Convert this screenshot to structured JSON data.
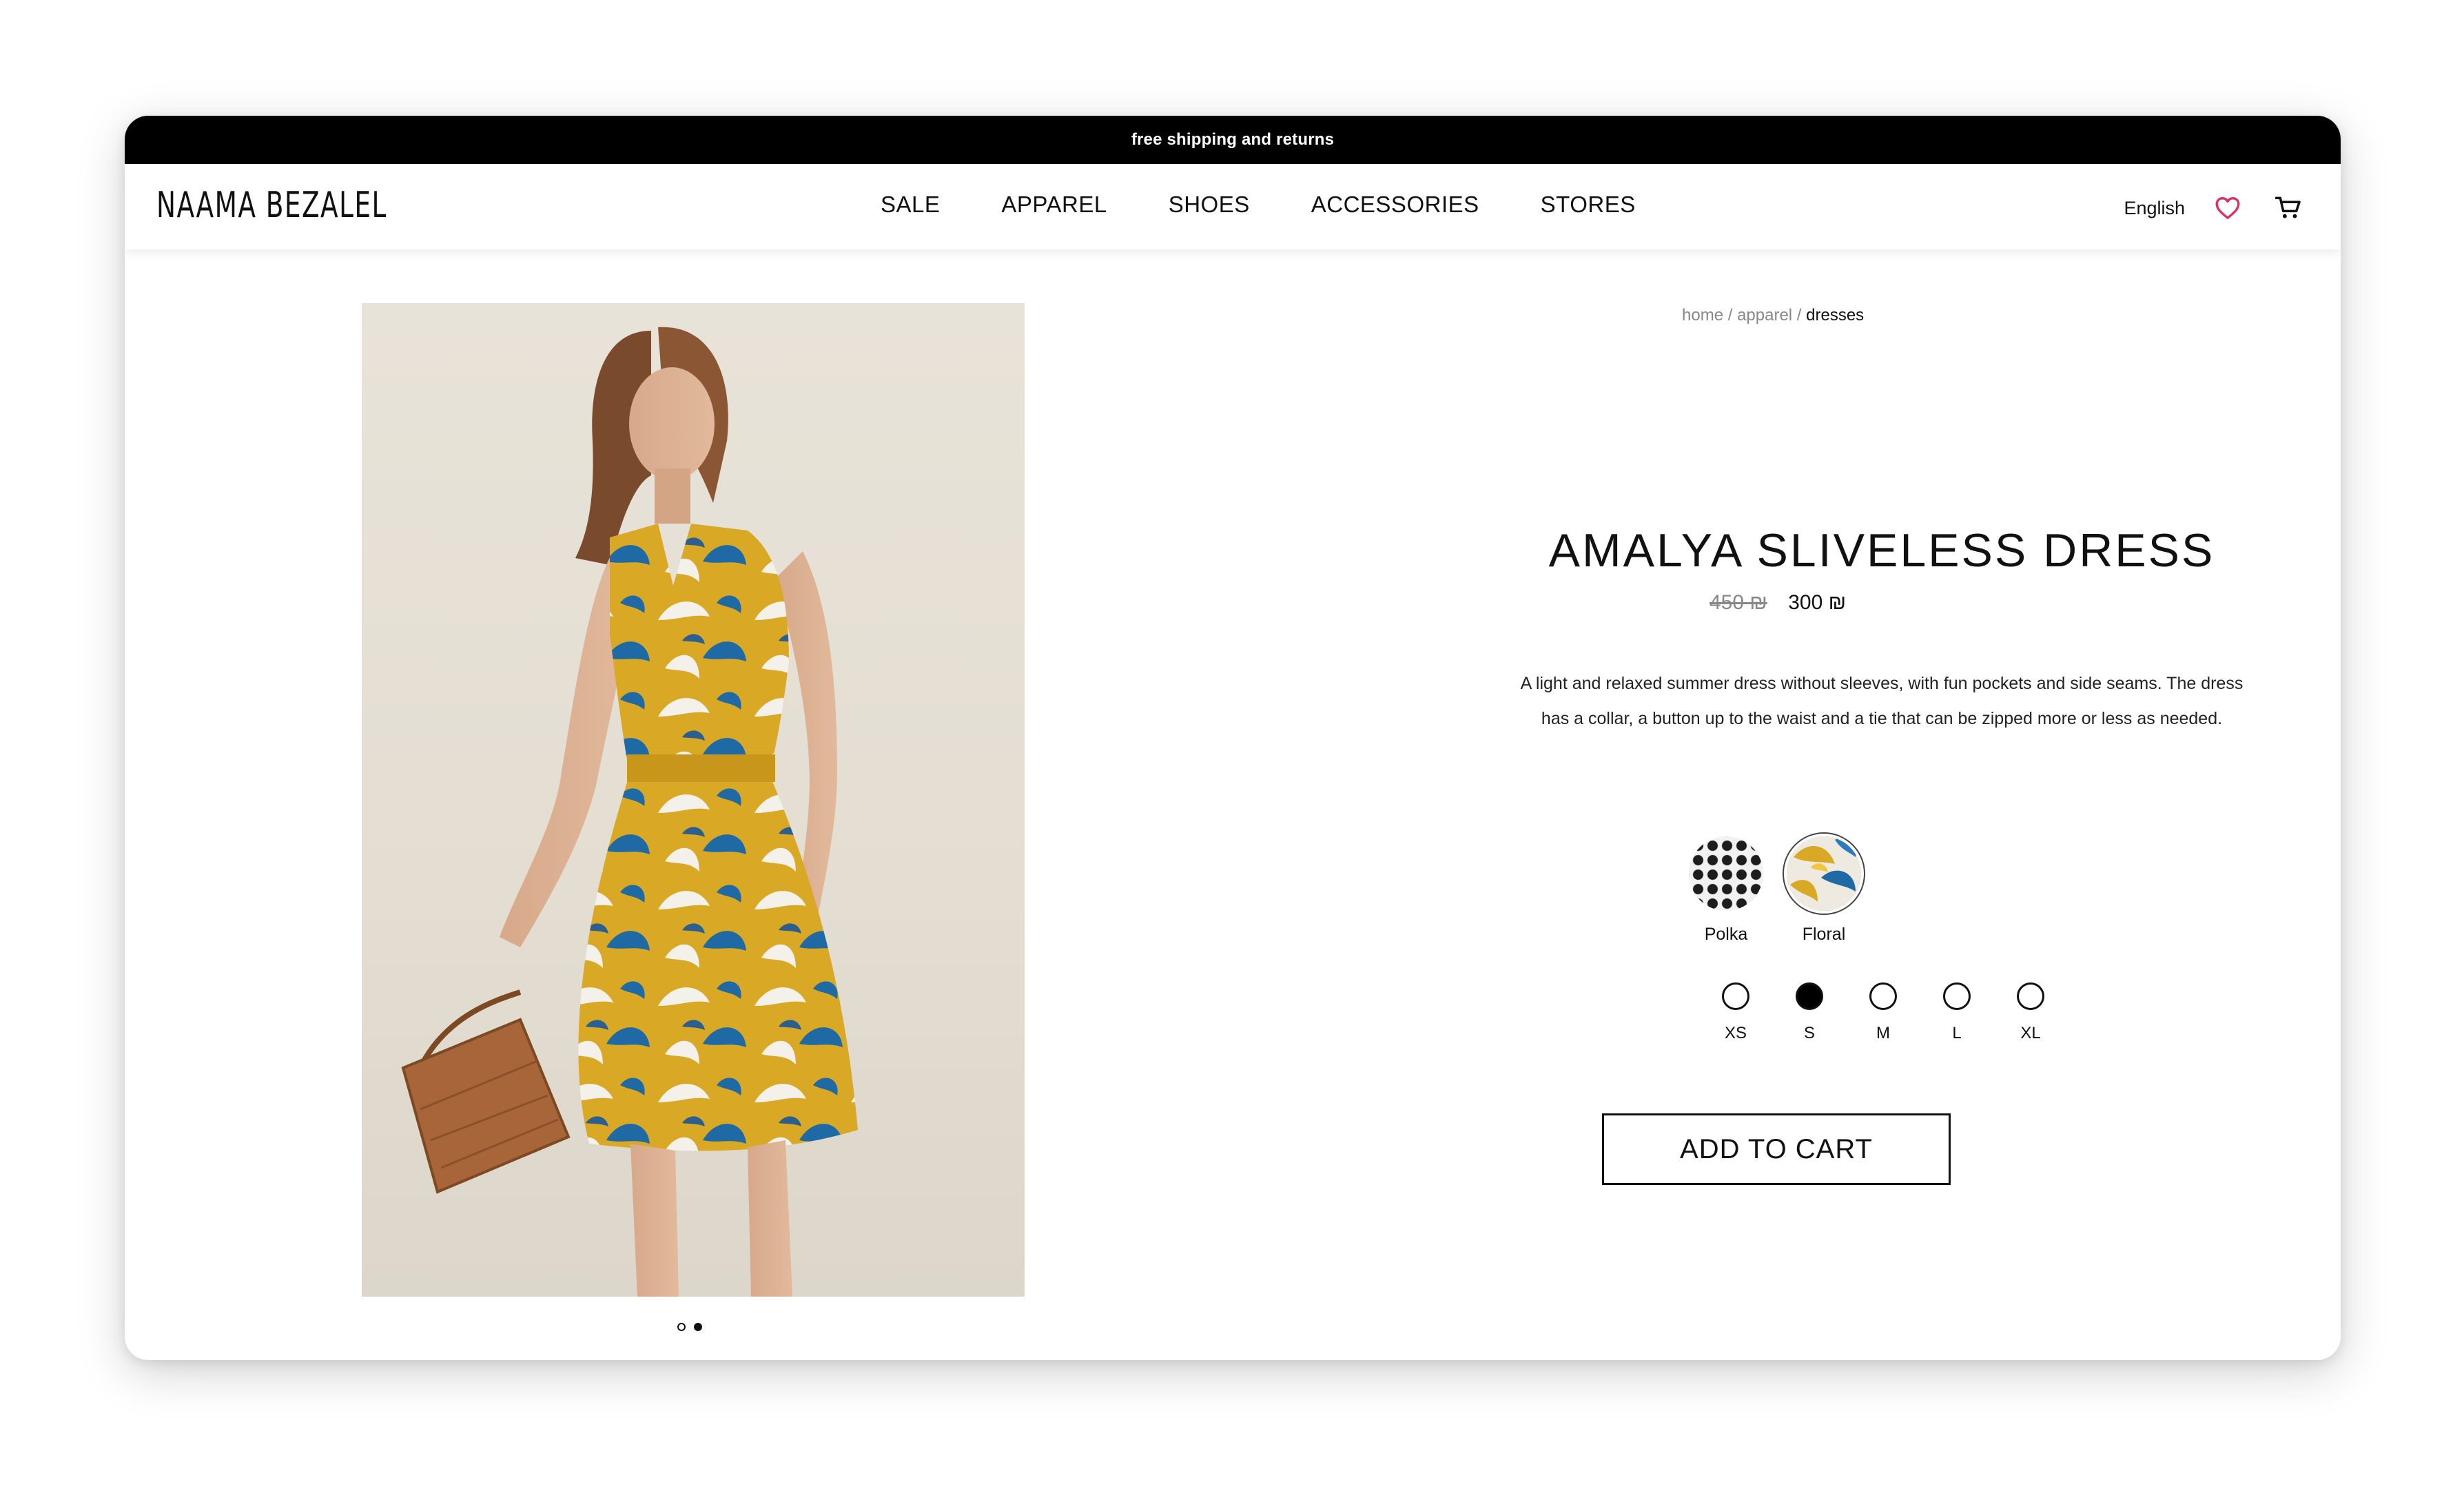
{
  "promo": {
    "text": "free shipping and returns"
  },
  "header": {
    "logo": "NAAMA BEZALEL",
    "nav": [
      "SALE",
      "APPAREL",
      "SHOES",
      "ACCESSORIES",
      "STORES"
    ],
    "language": "English",
    "icons": [
      "heart-icon",
      "cart-icon"
    ],
    "colors": {
      "heart": "#d6336c"
    }
  },
  "breadcrumb": {
    "home": "home",
    "apparel": "apparel",
    "current": "dresses",
    "separator": "/"
  },
  "product": {
    "title": "AMALYA SLIVELESS DRESS",
    "price_old": "450 ₪",
    "price_new": "300 ₪",
    "description": "A light and relaxed summer dress without sleeves, with fun pockets and side seams. The dress has a collar, a button up to the waist and a tie that can be zipped more or less as needed.",
    "patterns": [
      {
        "label": "Polka",
        "selected": false
      },
      {
        "label": "Floral",
        "selected": true
      }
    ],
    "sizes": [
      {
        "label": "XS",
        "selected": false
      },
      {
        "label": "S",
        "selected": true
      },
      {
        "label": "M",
        "selected": false
      },
      {
        "label": "L",
        "selected": false
      },
      {
        "label": "XL",
        "selected": false
      }
    ],
    "add_to_cart": "ADD TO CART",
    "image_dots": {
      "count": 2,
      "active_index": 1
    },
    "colors": {
      "dress_yellow": "#d9a824",
      "leaf_blue": "#1f6aa5",
      "leaf_white": "#f3f1ea",
      "background": "#e6e1d6"
    }
  }
}
